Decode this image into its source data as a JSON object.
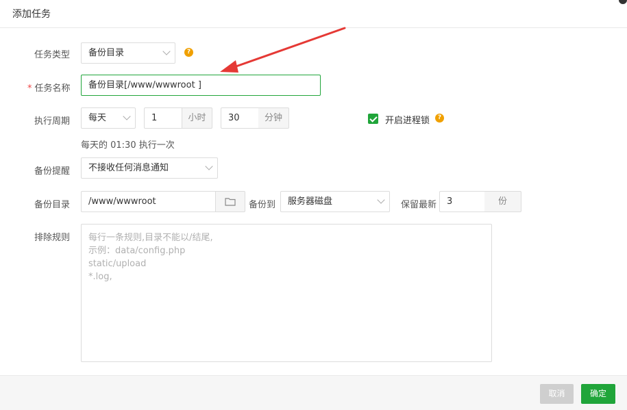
{
  "dialog": {
    "title": "添加任务"
  },
  "form": {
    "task_type": {
      "label": "任务类型",
      "value": "备份目录"
    },
    "task_name": {
      "label": "任务名称",
      "required_mark": "*",
      "value": "备份目录[/www/wwwroot ]"
    },
    "period": {
      "label": "执行周期",
      "frequency": "每天",
      "hour_value": "1",
      "hour_unit": "小时",
      "minute_value": "30",
      "minute_unit": "分钟",
      "summary": "每天的 01:30 执行一次"
    },
    "process_lock": {
      "label": "开启进程锁",
      "checked": true
    },
    "reminder": {
      "label": "备份提醒",
      "value": "不接收任何消息通知"
    },
    "backup_dir": {
      "label": "备份目录",
      "value": "/www/wwwroot"
    },
    "backup_to": {
      "label": "备份到",
      "value": "服务器磁盘"
    },
    "keep_latest": {
      "label": "保留最新",
      "value": "3",
      "unit": "份"
    },
    "exclude": {
      "label": "排除规则",
      "placeholder": [
        "每行一条规则,目录不能以/结尾,",
        "示例：data/config.php",
        "static/upload",
        "*.log,"
      ]
    }
  },
  "footer": {
    "cancel": "取消",
    "ok": "确定"
  },
  "colors": {
    "accent": "#20a53a",
    "help": "#f0a000",
    "annotation_arrow": "#e53935",
    "required": "#ef4444"
  },
  "icons": {
    "help": "help-icon",
    "folder": "folder-icon",
    "chevron": "chevron-down-icon",
    "check": "check-icon"
  }
}
